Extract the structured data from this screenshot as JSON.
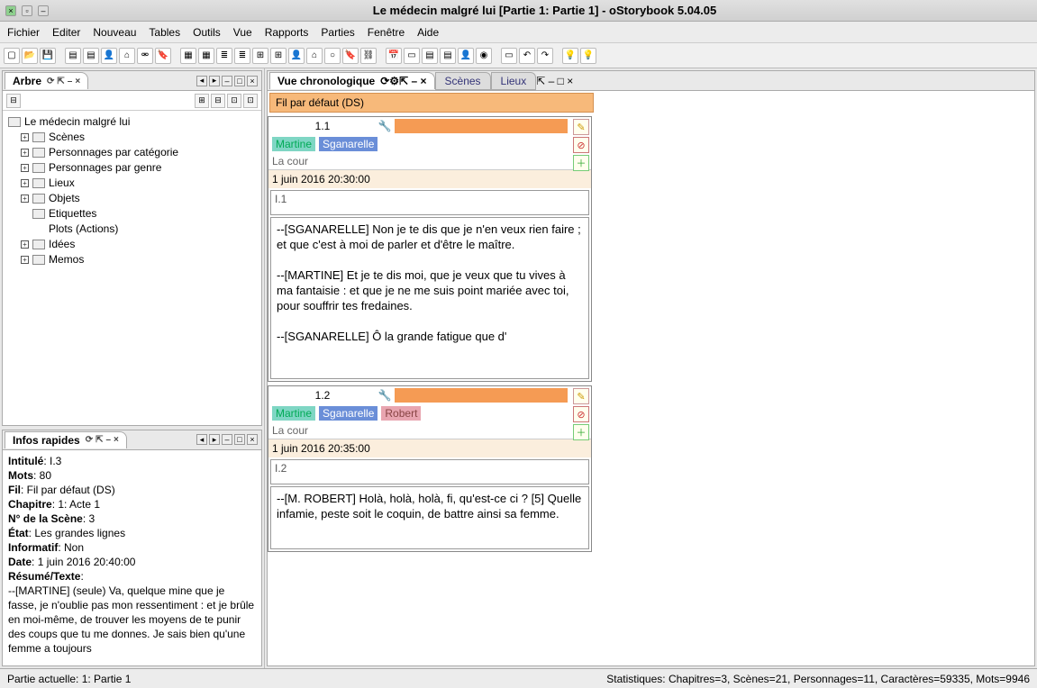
{
  "window": {
    "title": "Le médecin malgré lui [Partie 1: Partie 1] - oStorybook 5.04.05"
  },
  "menu": [
    "Fichier",
    "Editer",
    "Nouveau",
    "Tables",
    "Outils",
    "Vue",
    "Rapports",
    "Parties",
    "Fenêtre",
    "Aide"
  ],
  "arbre": {
    "title": "Arbre",
    "root": "Le médecin malgré lui",
    "nodes": [
      "Scènes",
      "Personnages par catégorie",
      "Personnages par genre",
      "Lieux",
      "Objets",
      "Etiquettes",
      "Plots (Actions)",
      "Idées",
      "Memos"
    ]
  },
  "infos": {
    "title": "Infos rapides",
    "fields": {
      "intitule_l": "Intitulé",
      "intitule_v": "I.3",
      "mots_l": "Mots",
      "mots_v": "80",
      "fil_l": "Fil",
      "fil_v": "Fil par défaut (DS)",
      "chap_l": "Chapitre",
      "chap_v": "1: Acte 1",
      "nscene_l": "N° de la Scène",
      "nscene_v": "3",
      "etat_l": "État",
      "etat_v": "Les grandes lignes",
      "info_l": "Informatif",
      "info_v": "Non",
      "date_l": "Date",
      "date_v": "1 juin 2016 20:40:00",
      "resume_l": "Résumé/Texte",
      "resume_v": "--[MARTINE] (seule) Va, quelque mine que je fasse, je n'oublie pas mon ressentiment : et je brûle en moi-même, de trouver les moyens de te punir des coups que tu me donnes. Je sais bien qu'une femme a toujours"
    }
  },
  "chrono": {
    "title": "Vue chronologique",
    "tabs": {
      "scenes": "Scènes",
      "lieux": "Lieux"
    },
    "strand": "Fil par défaut (DS)",
    "scenes": [
      {
        "num": "1.1",
        "chars": [
          {
            "name": "Martine",
            "cls": "teal"
          },
          {
            "name": "Sganarelle",
            "cls": "blue"
          }
        ],
        "loc": "La cour",
        "date": "1 juin 2016 20:30:00",
        "summary": "I.1",
        "text": "--[SGANARELLE] Non je te dis que je n'en veux rien faire ; et que c'est à moi de parler et d'être le maître.\n\n--[MARTINE] Et je te dis moi, que je veux que tu vives à ma fantaisie : et que je ne me suis point mariée avec toi, pour souffrir tes fredaines.\n\n--[SGANARELLE] Ô la grande fatigue que d'"
      },
      {
        "num": "1.2",
        "chars": [
          {
            "name": "Martine",
            "cls": "teal"
          },
          {
            "name": "Sganarelle",
            "cls": "blue"
          },
          {
            "name": "Robert",
            "cls": "pink"
          }
        ],
        "loc": "La cour",
        "date": "1 juin 2016 20:35:00",
        "summary": "I.2",
        "text": "--[M. ROBERT] Holà, holà, holà, fi, qu'est-ce ci ? [5] Quelle infamie, peste soit le coquin, de battre ainsi sa femme."
      }
    ]
  },
  "status": {
    "left": "Partie actuelle: 1: Partie 1",
    "right": "Statistiques: Chapitres=3,  Scènes=21,  Personnages=11,  Caractères=59335,  Mots=9946"
  }
}
